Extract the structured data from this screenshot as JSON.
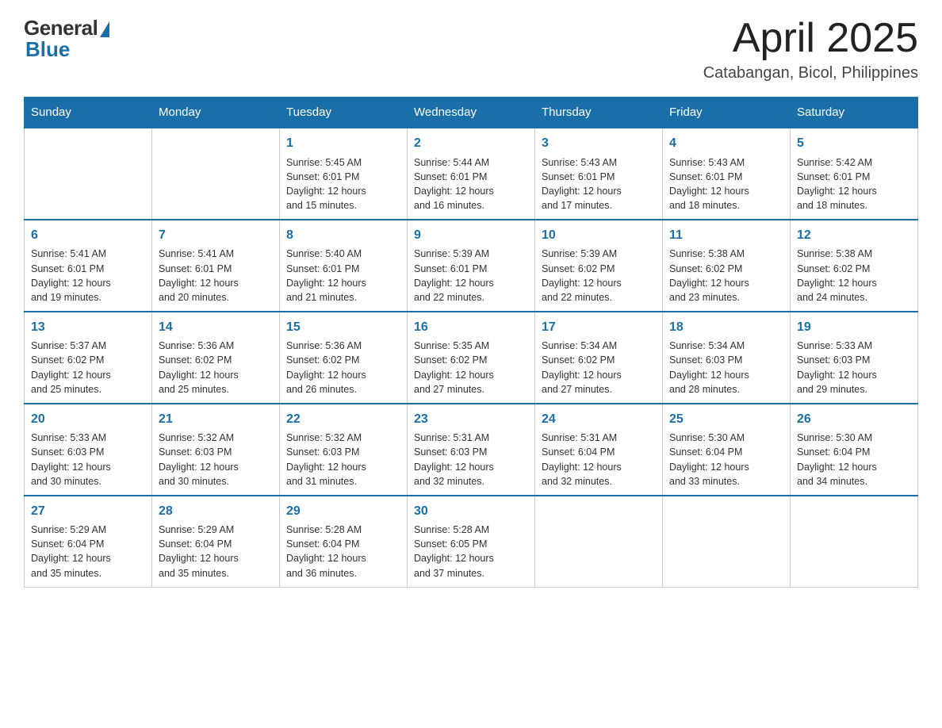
{
  "header": {
    "logo": {
      "general": "General",
      "blue": "Blue"
    },
    "title": "April 2025",
    "location": "Catabangan, Bicol, Philippines"
  },
  "days_of_week": [
    "Sunday",
    "Monday",
    "Tuesday",
    "Wednesday",
    "Thursday",
    "Friday",
    "Saturday"
  ],
  "weeks": [
    [
      {
        "day": "",
        "info": ""
      },
      {
        "day": "",
        "info": ""
      },
      {
        "day": "1",
        "info": "Sunrise: 5:45 AM\nSunset: 6:01 PM\nDaylight: 12 hours\nand 15 minutes."
      },
      {
        "day": "2",
        "info": "Sunrise: 5:44 AM\nSunset: 6:01 PM\nDaylight: 12 hours\nand 16 minutes."
      },
      {
        "day": "3",
        "info": "Sunrise: 5:43 AM\nSunset: 6:01 PM\nDaylight: 12 hours\nand 17 minutes."
      },
      {
        "day": "4",
        "info": "Sunrise: 5:43 AM\nSunset: 6:01 PM\nDaylight: 12 hours\nand 18 minutes."
      },
      {
        "day": "5",
        "info": "Sunrise: 5:42 AM\nSunset: 6:01 PM\nDaylight: 12 hours\nand 18 minutes."
      }
    ],
    [
      {
        "day": "6",
        "info": "Sunrise: 5:41 AM\nSunset: 6:01 PM\nDaylight: 12 hours\nand 19 minutes."
      },
      {
        "day": "7",
        "info": "Sunrise: 5:41 AM\nSunset: 6:01 PM\nDaylight: 12 hours\nand 20 minutes."
      },
      {
        "day": "8",
        "info": "Sunrise: 5:40 AM\nSunset: 6:01 PM\nDaylight: 12 hours\nand 21 minutes."
      },
      {
        "day": "9",
        "info": "Sunrise: 5:39 AM\nSunset: 6:01 PM\nDaylight: 12 hours\nand 22 minutes."
      },
      {
        "day": "10",
        "info": "Sunrise: 5:39 AM\nSunset: 6:02 PM\nDaylight: 12 hours\nand 22 minutes."
      },
      {
        "day": "11",
        "info": "Sunrise: 5:38 AM\nSunset: 6:02 PM\nDaylight: 12 hours\nand 23 minutes."
      },
      {
        "day": "12",
        "info": "Sunrise: 5:38 AM\nSunset: 6:02 PM\nDaylight: 12 hours\nand 24 minutes."
      }
    ],
    [
      {
        "day": "13",
        "info": "Sunrise: 5:37 AM\nSunset: 6:02 PM\nDaylight: 12 hours\nand 25 minutes."
      },
      {
        "day": "14",
        "info": "Sunrise: 5:36 AM\nSunset: 6:02 PM\nDaylight: 12 hours\nand 25 minutes."
      },
      {
        "day": "15",
        "info": "Sunrise: 5:36 AM\nSunset: 6:02 PM\nDaylight: 12 hours\nand 26 minutes."
      },
      {
        "day": "16",
        "info": "Sunrise: 5:35 AM\nSunset: 6:02 PM\nDaylight: 12 hours\nand 27 minutes."
      },
      {
        "day": "17",
        "info": "Sunrise: 5:34 AM\nSunset: 6:02 PM\nDaylight: 12 hours\nand 27 minutes."
      },
      {
        "day": "18",
        "info": "Sunrise: 5:34 AM\nSunset: 6:03 PM\nDaylight: 12 hours\nand 28 minutes."
      },
      {
        "day": "19",
        "info": "Sunrise: 5:33 AM\nSunset: 6:03 PM\nDaylight: 12 hours\nand 29 minutes."
      }
    ],
    [
      {
        "day": "20",
        "info": "Sunrise: 5:33 AM\nSunset: 6:03 PM\nDaylight: 12 hours\nand 30 minutes."
      },
      {
        "day": "21",
        "info": "Sunrise: 5:32 AM\nSunset: 6:03 PM\nDaylight: 12 hours\nand 30 minutes."
      },
      {
        "day": "22",
        "info": "Sunrise: 5:32 AM\nSunset: 6:03 PM\nDaylight: 12 hours\nand 31 minutes."
      },
      {
        "day": "23",
        "info": "Sunrise: 5:31 AM\nSunset: 6:03 PM\nDaylight: 12 hours\nand 32 minutes."
      },
      {
        "day": "24",
        "info": "Sunrise: 5:31 AM\nSunset: 6:04 PM\nDaylight: 12 hours\nand 32 minutes."
      },
      {
        "day": "25",
        "info": "Sunrise: 5:30 AM\nSunset: 6:04 PM\nDaylight: 12 hours\nand 33 minutes."
      },
      {
        "day": "26",
        "info": "Sunrise: 5:30 AM\nSunset: 6:04 PM\nDaylight: 12 hours\nand 34 minutes."
      }
    ],
    [
      {
        "day": "27",
        "info": "Sunrise: 5:29 AM\nSunset: 6:04 PM\nDaylight: 12 hours\nand 35 minutes."
      },
      {
        "day": "28",
        "info": "Sunrise: 5:29 AM\nSunset: 6:04 PM\nDaylight: 12 hours\nand 35 minutes."
      },
      {
        "day": "29",
        "info": "Sunrise: 5:28 AM\nSunset: 6:04 PM\nDaylight: 12 hours\nand 36 minutes."
      },
      {
        "day": "30",
        "info": "Sunrise: 5:28 AM\nSunset: 6:05 PM\nDaylight: 12 hours\nand 37 minutes."
      },
      {
        "day": "",
        "info": ""
      },
      {
        "day": "",
        "info": ""
      },
      {
        "day": "",
        "info": ""
      }
    ]
  ]
}
